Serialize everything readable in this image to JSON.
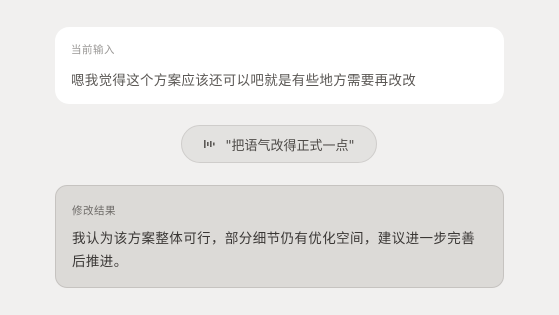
{
  "input_card": {
    "label": "当前输入",
    "text": "嗯我觉得这个方案应该还可以吧就是有些地方需要再改改"
  },
  "voice_command": {
    "icon": "waveform-icon",
    "text": "\"把语气改得正式一点\""
  },
  "result_card": {
    "label": "修改结果",
    "text": "我认为该方案整体可行，部分细节仍有优化空间，建议进一步完善后推进。"
  }
}
